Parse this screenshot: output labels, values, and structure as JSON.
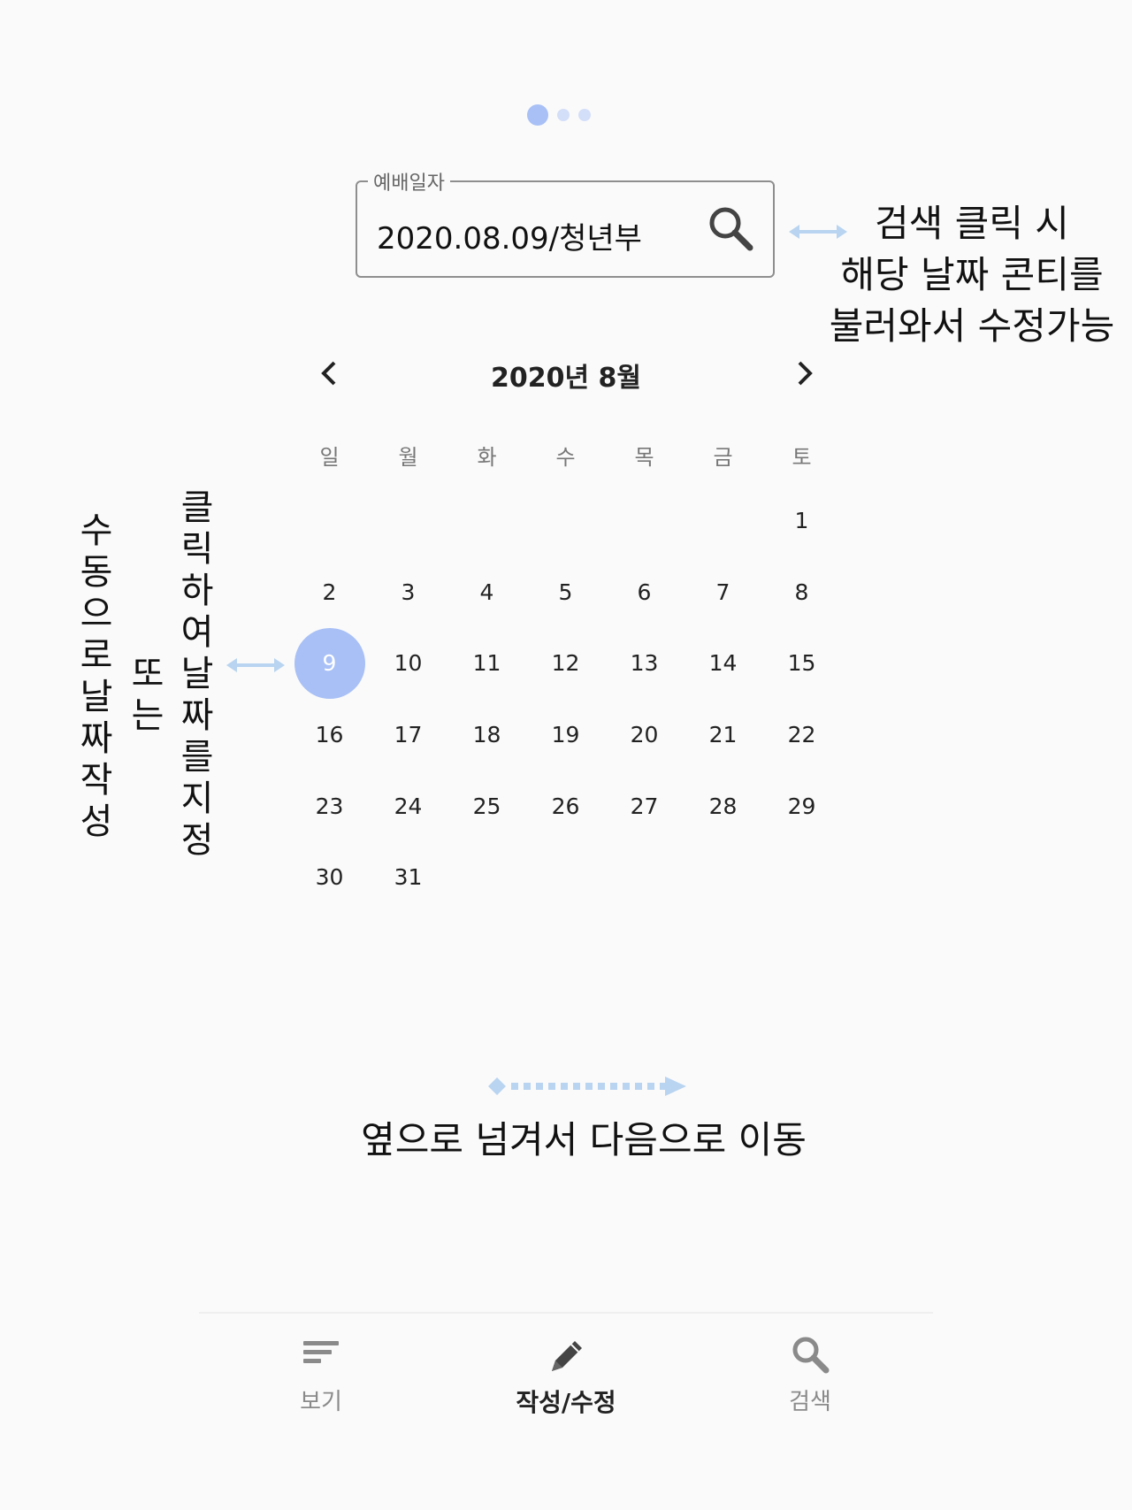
{
  "pager": {
    "pages": 3,
    "current": 1
  },
  "date_field": {
    "legend": "예배일자",
    "value": "2020.08.09/청년부",
    "icon": "search-icon"
  },
  "annotations": {
    "search_note": [
      "검색 클릭 시",
      "해당 날짜 콘티를",
      "불러와서 수정가능"
    ],
    "manual_col": [
      "수",
      "동",
      "으",
      "로",
      "날",
      "짜",
      "작",
      "성"
    ],
    "or_col": [
      "또",
      "는"
    ],
    "click_col": [
      "클",
      "릭",
      "하",
      "여",
      "날",
      "짜",
      "를",
      "지",
      "정"
    ],
    "swipe_note": "옆으로 넘겨서 다음으로 이동"
  },
  "calendar": {
    "title": "2020년 8월",
    "prev_icon": "chevron-left-icon",
    "next_icon": "chevron-right-icon",
    "weekdays": [
      "일",
      "월",
      "화",
      "수",
      "목",
      "금",
      "토"
    ],
    "selected": "9",
    "weeks": [
      [
        "",
        "",
        "",
        "",
        "",
        "",
        "1"
      ],
      [
        "2",
        "3",
        "4",
        "5",
        "6",
        "7",
        "8"
      ],
      [
        "9",
        "10",
        "11",
        "12",
        "13",
        "14",
        "15"
      ],
      [
        "16",
        "17",
        "18",
        "19",
        "20",
        "21",
        "22"
      ],
      [
        "23",
        "24",
        "25",
        "26",
        "27",
        "28",
        "29"
      ],
      [
        "30",
        "31",
        "",
        "",
        "",
        "",
        ""
      ]
    ]
  },
  "colors": {
    "accent": "#a8c0f6",
    "arrow": "#b9d4f0"
  },
  "nav": {
    "items": [
      {
        "label": "보기",
        "icon": "list-icon"
      },
      {
        "label": "작성/수정",
        "icon": "pencil-icon"
      },
      {
        "label": "검색",
        "icon": "search-icon"
      }
    ],
    "active": 1
  }
}
